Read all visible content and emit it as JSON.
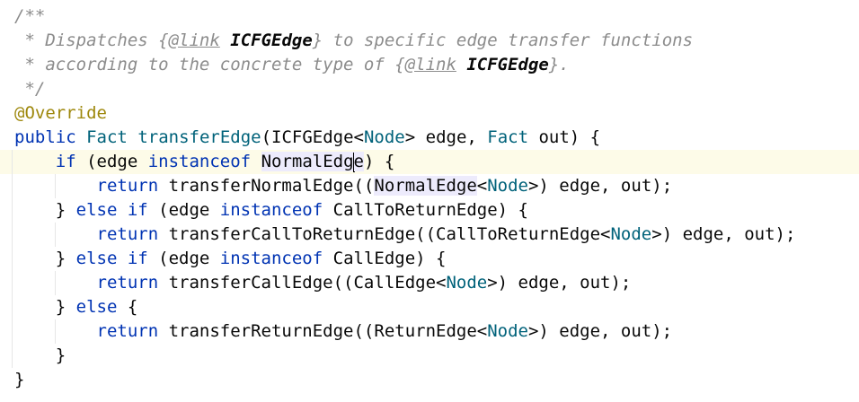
{
  "code": {
    "lines": [
      {
        "tokens": [
          [
            "c",
            "/**"
          ]
        ]
      },
      {
        "tokens": [
          [
            "c",
            " * Dispatches {"
          ],
          [
            "tag",
            "@link"
          ],
          [
            "c",
            " "
          ],
          [
            "tref",
            "ICFGEdge"
          ],
          [
            "c",
            "} to specific edge transfer functions"
          ]
        ]
      },
      {
        "tokens": [
          [
            "c",
            " * according to the concrete type of {"
          ],
          [
            "tag",
            "@link"
          ],
          [
            "c",
            " "
          ],
          [
            "tref",
            "ICFGEdge"
          ],
          [
            "c",
            "}."
          ]
        ]
      },
      {
        "tokens": [
          [
            "c",
            " */"
          ]
        ]
      },
      {
        "tokens": [
          [
            "ann",
            "@Override"
          ]
        ]
      },
      {
        "tokens": [
          [
            "kw",
            "public"
          ],
          [
            "pl",
            " "
          ],
          [
            "ty",
            "Fact"
          ],
          [
            "pl",
            " "
          ],
          [
            "ty",
            "transferEdge"
          ],
          [
            "pl",
            "(ICFGEdge<"
          ],
          [
            "tp",
            "Node"
          ],
          [
            "pl",
            "> edge, "
          ],
          [
            "ty",
            "Fact"
          ],
          [
            "pl",
            " out) {"
          ]
        ]
      },
      {
        "current": true,
        "tokens": [
          [
            "pl",
            "    "
          ],
          [
            "kw",
            "if"
          ],
          [
            "pl",
            " (edge "
          ],
          [
            "kw",
            "instanceof"
          ],
          [
            "pl",
            " "
          ],
          [
            "hl",
            "NormalEdg"
          ],
          [
            "caret",
            ""
          ],
          [
            "hl",
            "e"
          ],
          [
            "pl",
            ") {"
          ]
        ]
      },
      {
        "tokens": [
          [
            "pl",
            "        "
          ],
          [
            "kw",
            "return"
          ],
          [
            "pl",
            " transferNormalEdge(("
          ],
          [
            "hl",
            "NormalEdge"
          ],
          [
            "pl",
            "<"
          ],
          [
            "tp",
            "Node"
          ],
          [
            "pl",
            ">) edge, out);"
          ]
        ]
      },
      {
        "tokens": [
          [
            "pl",
            "    } "
          ],
          [
            "kw",
            "else if"
          ],
          [
            "pl",
            " (edge "
          ],
          [
            "kw",
            "instanceof"
          ],
          [
            "pl",
            " CallToReturnEdge) {"
          ]
        ]
      },
      {
        "tokens": [
          [
            "pl",
            "        "
          ],
          [
            "kw",
            "return"
          ],
          [
            "pl",
            " transferCallToReturnEdge((CallToReturnEdge<"
          ],
          [
            "tp",
            "Node"
          ],
          [
            "pl",
            ">) edge, out);"
          ]
        ]
      },
      {
        "tokens": [
          [
            "pl",
            "    } "
          ],
          [
            "kw",
            "else if"
          ],
          [
            "pl",
            " (edge "
          ],
          [
            "kw",
            "instanceof"
          ],
          [
            "pl",
            " CallEdge) {"
          ]
        ]
      },
      {
        "tokens": [
          [
            "pl",
            "        "
          ],
          [
            "kw",
            "return"
          ],
          [
            "pl",
            " transferCallEdge((CallEdge<"
          ],
          [
            "tp",
            "Node"
          ],
          [
            "pl",
            ">) edge, out);"
          ]
        ]
      },
      {
        "tokens": [
          [
            "pl",
            "    } "
          ],
          [
            "kw",
            "else"
          ],
          [
            "pl",
            " {"
          ]
        ]
      },
      {
        "tokens": [
          [
            "pl",
            "        "
          ],
          [
            "kw",
            "return"
          ],
          [
            "pl",
            " transferReturnEdge((ReturnEdge<"
          ],
          [
            "tp",
            "Node"
          ],
          [
            "pl",
            ">) edge, out);"
          ]
        ]
      },
      {
        "tokens": [
          [
            "pl",
            "    }"
          ]
        ]
      },
      {
        "tokens": [
          [
            "pl",
            "}"
          ]
        ]
      }
    ]
  },
  "colors": {
    "comment": "#8c8c8c",
    "keyword": "#0033b3",
    "type": "#00627a",
    "annotation": "#9e880d",
    "plain": "#080808",
    "current_line": "#fdfbe8",
    "highlight": "#edebfc"
  }
}
